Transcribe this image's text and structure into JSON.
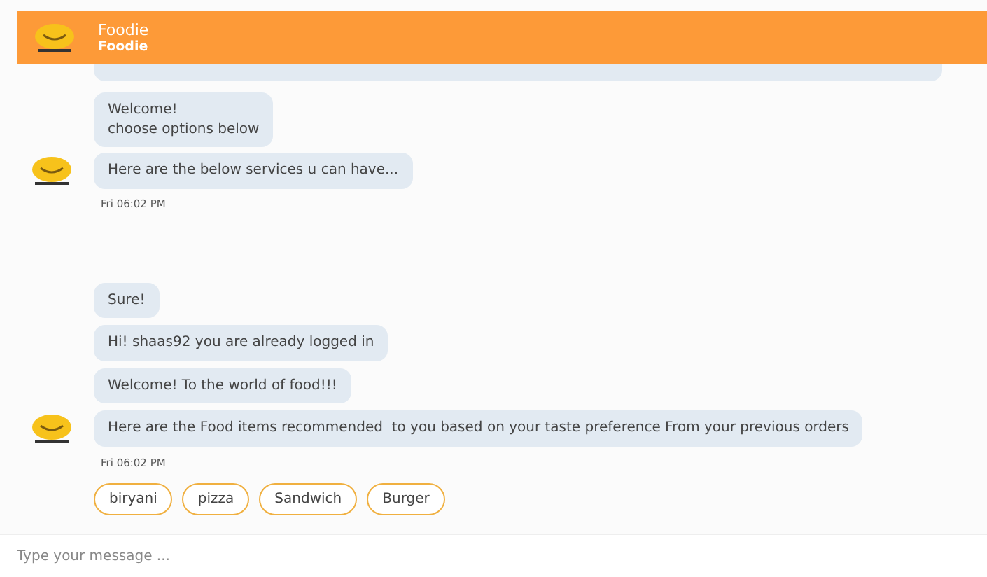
{
  "header": {
    "title": "Foodie",
    "subtitle": "Foodie"
  },
  "groups": [
    {
      "messages": [
        {
          "text": "Welcome!\nchoose options below"
        },
        {
          "text": "Here are the below services u can have..."
        }
      ],
      "time": "Fri 06:02 PM"
    },
    {
      "messages": [
        {
          "text": "Sure!"
        },
        {
          "text": "Hi! shaas92 you are already logged in"
        },
        {
          "text": "Welcome! To the world of food!!!"
        },
        {
          "text": "Here are the Food items recommended  to you based on your taste preference From your previous orders"
        }
      ],
      "time": "Fri 06:02 PM"
    }
  ],
  "chips": [
    "biryani",
    "pizza",
    "Sandwich",
    "Burger"
  ],
  "composer": {
    "placeholder": "Type your message ..."
  }
}
